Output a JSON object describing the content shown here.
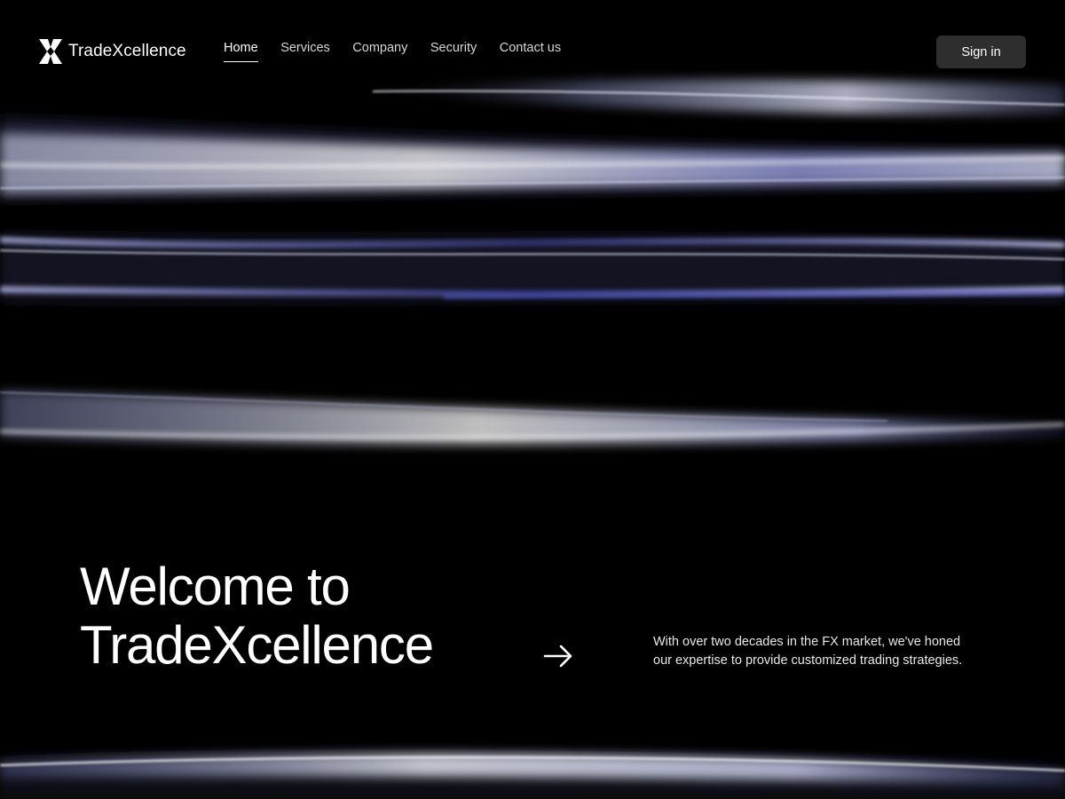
{
  "brand": {
    "name": "TradeXcellence",
    "logo_icon": "x-mark-icon"
  },
  "nav": {
    "items": [
      {
        "label": "Home",
        "active": true
      },
      {
        "label": "Services",
        "active": false
      },
      {
        "label": "Company",
        "active": false
      },
      {
        "label": "Security",
        "active": false
      },
      {
        "label": "Contact us",
        "active": false
      }
    ],
    "sign_in_label": "Sign in"
  },
  "hero": {
    "headline_line1": "Welcome to",
    "headline_line2": "TradeXcellence",
    "arrow_icon": "arrow-right-icon",
    "tagline_line1": "With over two decades in the FX market, we've honed",
    "tagline_line2": "our expertise to provide customized trading strategies."
  },
  "colors": {
    "background": "#000000",
    "button_bg": "#2e2e2f",
    "ribbon_highlight": "#b9bde6",
    "ribbon_accent": "#5b63c9"
  }
}
